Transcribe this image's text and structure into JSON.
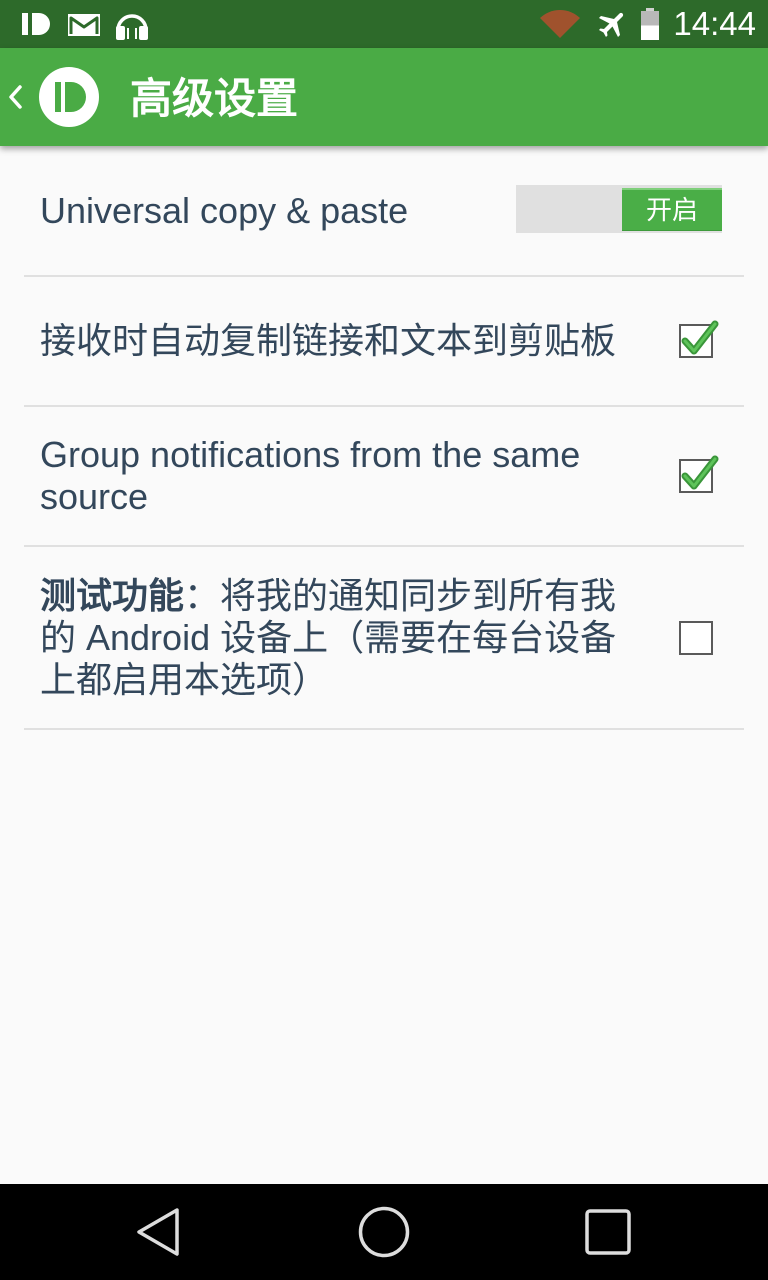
{
  "status_bar": {
    "time": "14:44",
    "left_icons": [
      "pushbullet-icon",
      "gmail-icon",
      "headphones-icon"
    ],
    "right_icons": [
      "wifi-icon",
      "airplane-mode-icon",
      "battery-icon"
    ],
    "battery_level": 0.5
  },
  "app_bar": {
    "title": "高级设置",
    "back_icon": "chevron-left-icon",
    "logo_icon": "pushbullet-logo-icon"
  },
  "settings": [
    {
      "label": "Universal copy & paste",
      "toggle_label": "开启",
      "enabled": true
    },
    {
      "label": "接收时自动复制链接和文本到剪贴板",
      "checked": true
    },
    {
      "label": "Group notifications from the same source",
      "checked": true
    },
    {
      "label_bold": "测试功能",
      "label": "：将我的通知同步到所有我的 Android 设备上（需要在每台设备上都启用本选项）",
      "checked": false
    }
  ],
  "nav_bar": {
    "icons": [
      "back-icon",
      "home-icon",
      "recents-icon"
    ]
  },
  "colors": {
    "status_bar": "#2d6a2a",
    "accent": "#4aab45",
    "text": "#33475b",
    "wifi": "#a0522d",
    "background": "#fafafa"
  }
}
